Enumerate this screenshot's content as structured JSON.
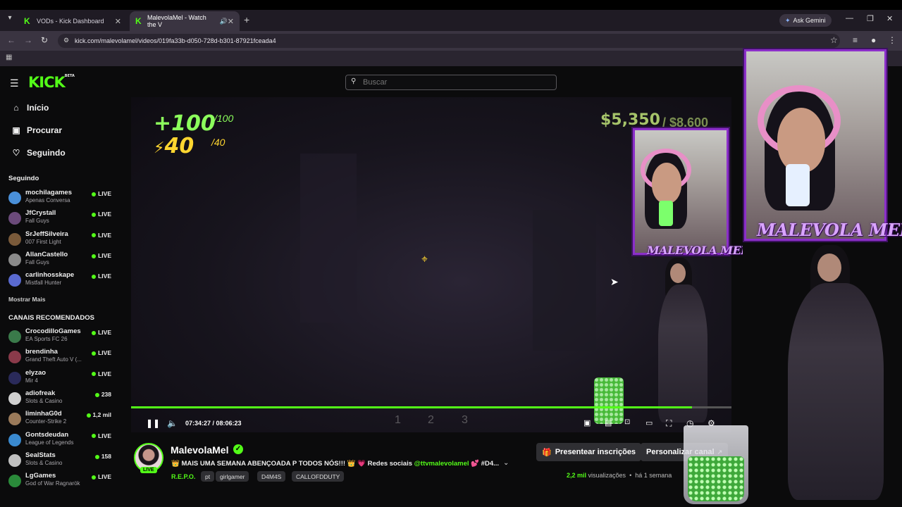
{
  "browser": {
    "tabs": [
      {
        "title": "VODs - Kick Dashboard",
        "icon": "kick-favicon"
      },
      {
        "title": "MalevolaMel - Watch the V",
        "icon": "kick-favicon"
      }
    ],
    "new_tab_label": "+",
    "gemini_label": "Ask Gemini",
    "url": "kick.com/malevolamel/videos/019fa33b-d050-728d-b301-87921fceada4"
  },
  "header": {
    "logo_text": "KICK",
    "logo_beta": "BETA",
    "search_placeholder": "Buscar"
  },
  "sidebar": {
    "nav": [
      {
        "label": "Início",
        "icon": "home-icon"
      },
      {
        "label": "Procurar",
        "icon": "browse-icon"
      },
      {
        "label": "Seguindo",
        "icon": "heart-icon"
      }
    ],
    "following_title": "Seguindo",
    "following": [
      {
        "name": "mochilagames",
        "game": "Apenas Conversa",
        "status": "LIVE",
        "color": "#4a90d9"
      },
      {
        "name": "JfCrystall",
        "game": "Fall Guys",
        "status": "LIVE",
        "color": "#6b4a7a"
      },
      {
        "name": "SrJeffSilveira",
        "game": "007 First Light",
        "status": "LIVE",
        "color": "#7a5a3a"
      },
      {
        "name": "AllanCastello",
        "game": "Fall Guys",
        "status": "LIVE",
        "color": "#8a8a8a"
      },
      {
        "name": "carlinhosskape",
        "game": "Mistfall Hunter",
        "status": "LIVE",
        "color": "#5a6ad0"
      }
    ],
    "show_more": "Mostrar Mais",
    "recommended_title": "CANAIS RECOMENDADOS",
    "recommended": [
      {
        "name": "CrocodilloGames",
        "game": "EA Sports FC 26",
        "status": "LIVE",
        "color": "#3a7a4a"
      },
      {
        "name": "brendinha",
        "game": "Grand Theft Auto V (...",
        "status": "LIVE",
        "color": "#8a3a4a"
      },
      {
        "name": "elyzao",
        "game": "Mir 4",
        "status": "LIVE",
        "color": "#2a2a5a"
      },
      {
        "name": "adiofreak",
        "game": "Slots & Casino",
        "status": "238",
        "color": "#d0d0d0"
      },
      {
        "name": "liminhaG0d",
        "game": "Counter-Strike 2",
        "status": "1,2 mil",
        "color": "#9a7a5a"
      },
      {
        "name": "Gontsdeudan",
        "game": "League of Legends",
        "status": "LIVE",
        "color": "#3a8ad0"
      },
      {
        "name": "SealStats",
        "game": "Slots & Casino",
        "status": "158",
        "color": "#c0c0c0"
      },
      {
        "name": "LgGames",
        "game": "God of War Ragnarök",
        "status": "LIVE",
        "color": "#2a8a3a"
      }
    ]
  },
  "video": {
    "hud_health": "+100",
    "hud_health_max": "/100",
    "hud_energy": "40",
    "hud_energy_max": "/40",
    "hud_money": "$5,350",
    "hud_money2": "/ $8,600",
    "current_time": "07:34:27",
    "duration": "08:06:23",
    "time_display": "07:34:27 / 08:06:23",
    "progress": 0.934,
    "slots": [
      "1",
      "2",
      "3"
    ],
    "overlay_name": "MALEVOLA MEL"
  },
  "channel": {
    "name": "MalevolaMel",
    "live_badge": "LIVE",
    "title_prefix": "👑 MAIS UMA SEMANA ABENÇOADA P TODOS NÓS!!! 👑 💗 Redes sociais",
    "title_mention": "@ttvmalevolamel",
    "title_suffix": "💕 #D4...",
    "category": "R.E.P.O.",
    "tags": [
      "pt",
      "girlgamer",
      "D4M4S",
      "CALLOFDDUTY"
    ],
    "gift_button": "Presentear inscrições",
    "customize_button": "Personalizar canal",
    "views_count": "2,2 mil",
    "views_label": "visualizações",
    "posted": "há 1 semana"
  }
}
